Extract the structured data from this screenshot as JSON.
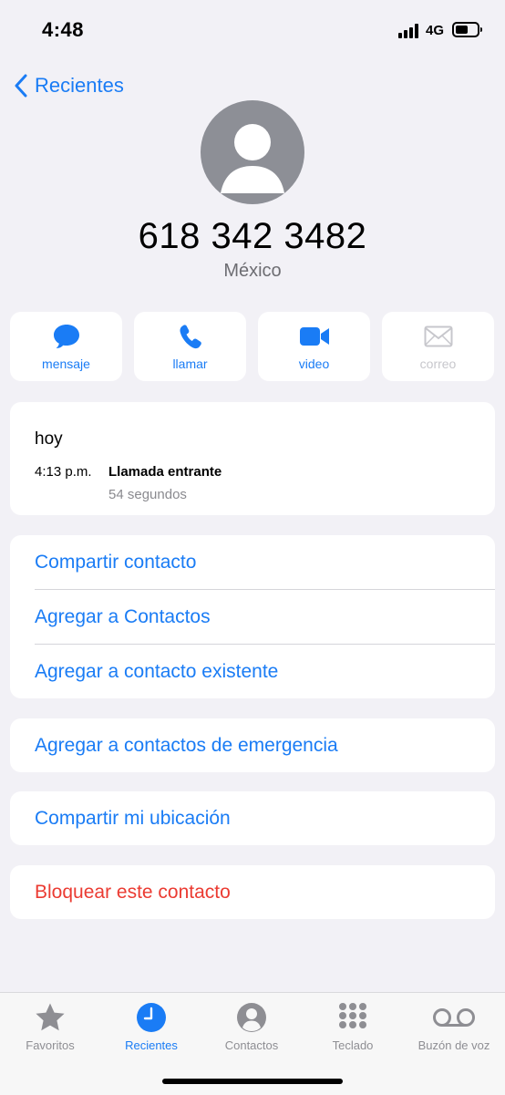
{
  "status_bar": {
    "time": "4:48",
    "network": "4G",
    "battery_level": 0.6
  },
  "nav": {
    "back_label": "Recientes"
  },
  "contact": {
    "number": "618 342 3482",
    "location": "México"
  },
  "actions": [
    {
      "label": "mensaje",
      "icon": "message-bubble-icon",
      "enabled": true
    },
    {
      "label": "llamar",
      "icon": "phone-icon",
      "enabled": true
    },
    {
      "label": "video",
      "icon": "video-camera-icon",
      "enabled": true
    },
    {
      "label": "correo",
      "icon": "envelope-icon",
      "enabled": false
    }
  ],
  "call_history": {
    "day": "hoy",
    "entries": [
      {
        "time": "4:13 p.m.",
        "type": "Llamada entrante",
        "duration": "54 segundos"
      }
    ]
  },
  "contact_options": [
    "Compartir contacto",
    "Agregar a Contactos",
    "Agregar a contacto existente"
  ],
  "emergency_option": "Agregar a contactos de emergencia",
  "location_option": "Compartir mi ubicación",
  "block_option": "Bloquear este contacto",
  "colors": {
    "accent": "#1a7cf5",
    "danger": "#eb3b32",
    "background": "#f2f1f6"
  },
  "tab_bar": {
    "active_index": 1,
    "tabs": [
      {
        "label": "Favoritos",
        "icon": "star-icon"
      },
      {
        "label": "Recientes",
        "icon": "clock-icon"
      },
      {
        "label": "Contactos",
        "icon": "person-circle-icon"
      },
      {
        "label": "Teclado",
        "icon": "keypad-icon"
      },
      {
        "label": "Buzón de voz",
        "icon": "voicemail-icon"
      }
    ]
  }
}
